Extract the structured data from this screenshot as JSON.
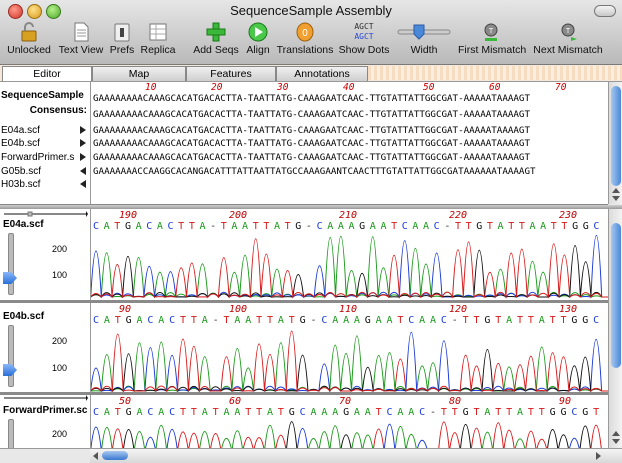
{
  "window": {
    "title": "SequenceSample Assembly"
  },
  "toolbar": {
    "unlocked": "Unlocked",
    "text_view": "Text View",
    "prefs": "Prefs",
    "replica": "Replica",
    "add_seqs": "Add Seqs",
    "align": "Align",
    "translations": "Translations",
    "show_dots": "Show Dots",
    "show_dots_icon_top": "AGCT",
    "show_dots_icon_bottom": "AGCT",
    "width": "Width",
    "first_mismatch": "First Mismatch",
    "next_mismatch": "Next Mismatch"
  },
  "tabs": {
    "editor": "Editor",
    "map": "Map",
    "features": "Features",
    "annotations": "Annotations"
  },
  "sequence_pane": {
    "ruler": [
      "10",
      "20",
      "30",
      "40",
      "50",
      "60",
      "70"
    ],
    "rows": [
      {
        "name": "SequenceSample",
        "seq": "GAAAAAAAACAAAGCACATGACACTTA-TAATTATG-CAAAGAATCAAC-TTGTATTATTGGCGAT-AAAAATAAAAGT"
      },
      {
        "name": "Consensus:",
        "seq": "GAAAAAAAACAAAGCACATGACACTTA-TAATTATG-CAAAGAATCAAC-TTGTATTATTGGCGAT-AAAAATAAAAGT"
      },
      {
        "name": "E04a.scf",
        "seq": "GAAAAAAAACAAAGCACATGACACTTA-TAATTATG-CAAAGAATCAAC-TTGTATTATTGGCGAT-AAAAATAAAAGT"
      },
      {
        "name": "E04b.scf",
        "seq": "GAAAAAAAACAAAGCACATGACACTTA-TAATTATG-CAAAGAATCAAC-TTGTATTATTGGCGAT-AAAAATAAAAGT"
      },
      {
        "name": "ForwardPrimer.s",
        "seq": "GAAAAAAAACAAAGCACATGACACTTA-TAATTATG-CAAAGAATCAAC-TTGTATTATTGGCGAT-AAAAATAAAAGT"
      },
      {
        "name": "G05b.scf",
        "seq": "GAAAAAAACCAAGGCACANGACATTTATTAATTATGCCAAAGAANTCAACTTTGTATTATTGGCGATAAAAAATAAAAGT"
      },
      {
        "name": "H03b.scf",
        "seq": ""
      }
    ]
  },
  "traces": [
    {
      "name": "E04a.scf",
      "ticks": [
        "200",
        "100"
      ],
      "positions": [
        "190",
        "200",
        "210",
        "220",
        "230"
      ],
      "bases": "CATGACACTTA-TAATTATG-CAAAGAATCAAC-TTGTATTAATTGGC"
    },
    {
      "name": "E04b.scf",
      "ticks": [
        "200",
        "100"
      ],
      "positions": [
        "90",
        "100",
        "110",
        "120",
        "130"
      ],
      "bases": "CATGACACTTA-TAATTATG-CAAAGAATCAAC-TTGTATTATTGGC"
    },
    {
      "name": "ForwardPrimer.sc",
      "ticks": [
        "200"
      ],
      "positions": [
        "50",
        "60",
        "70",
        "80",
        "90"
      ],
      "bases": "CATGACACTTATAATTATGCAAAGAATCAAC-TTGTATTATTGGCGT"
    }
  ],
  "colors": {
    "A": "#1a9a1a",
    "C": "#1a3ad8",
    "G": "#111111",
    "T": "#d81a1a",
    "position": "#c00000",
    "scroll_accent": "#4a88d8"
  }
}
